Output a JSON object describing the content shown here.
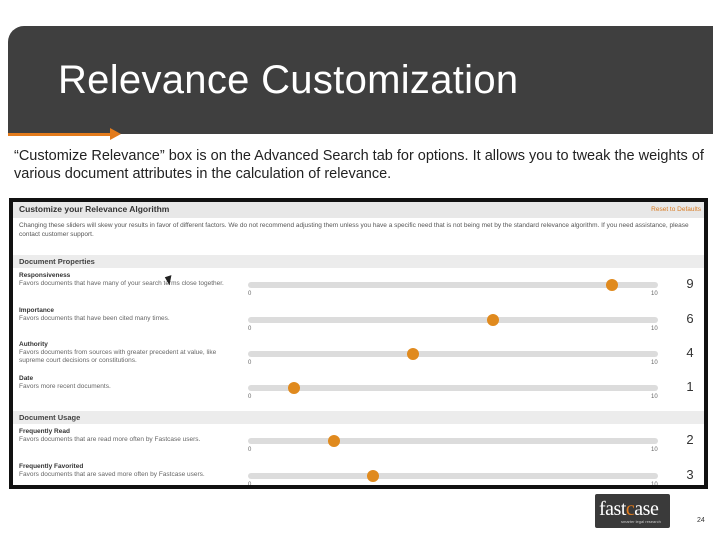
{
  "slide": {
    "title": "Relevance Customization",
    "body": "“Customize Relevance” box is on the Advanced Search tab for options. It allows you to tweak the weights of various document attributes in the calculation of relevance.",
    "page_number": "24"
  },
  "panel": {
    "header": "Customize your Relevance Algorithm",
    "reset": "Reset to Defaults",
    "description": "Changing these sliders will skew your results in favor of different factors. We do not recommend adjusting them unless you have a specific need that is not being met by the standard relevance algorithm. If you need assistance, please contact customer support.",
    "sections": [
      {
        "title": "Document Properties",
        "rows": [
          {
            "title": "Responsiveness",
            "desc": "Favors documents that have many of your search terms close together.",
            "value": 9,
            "min": "0",
            "max": "10",
            "value_label": "9"
          },
          {
            "title": "Importance",
            "desc": "Favors documents that have been cited many times.",
            "value": 6,
            "min": "0",
            "max": "10",
            "value_label": "6"
          },
          {
            "title": "Authority",
            "desc": "Favors documents from sources with greater precedent at value, like supreme court decisions or constitutions.",
            "value": 4,
            "min": "0",
            "max": "10",
            "value_label": "4"
          },
          {
            "title": "Date",
            "desc": "Favors more recent documents.",
            "value": 1,
            "min": "0",
            "max": "10",
            "value_label": "1"
          }
        ]
      },
      {
        "title": "Document Usage",
        "rows": [
          {
            "title": "Frequently Read",
            "desc": "Favors documents that are read more often by Fastcase users.",
            "value": 2,
            "min": "0",
            "max": "10",
            "value_label": "2"
          },
          {
            "title": "Frequently Favorited",
            "desc": "Favors documents that are saved more often by Fastcase users.",
            "value": 3,
            "min": "0",
            "max": "10",
            "value_label": "3"
          }
        ]
      }
    ]
  },
  "logo": {
    "text_pre": "fast",
    "text_accent": "c",
    "text_post": "ase",
    "tagline": "smarter legal research"
  },
  "colors": {
    "title_bar": "#3f3f3f",
    "accent": "#e37b1c",
    "knob": "#e08a1e"
  }
}
